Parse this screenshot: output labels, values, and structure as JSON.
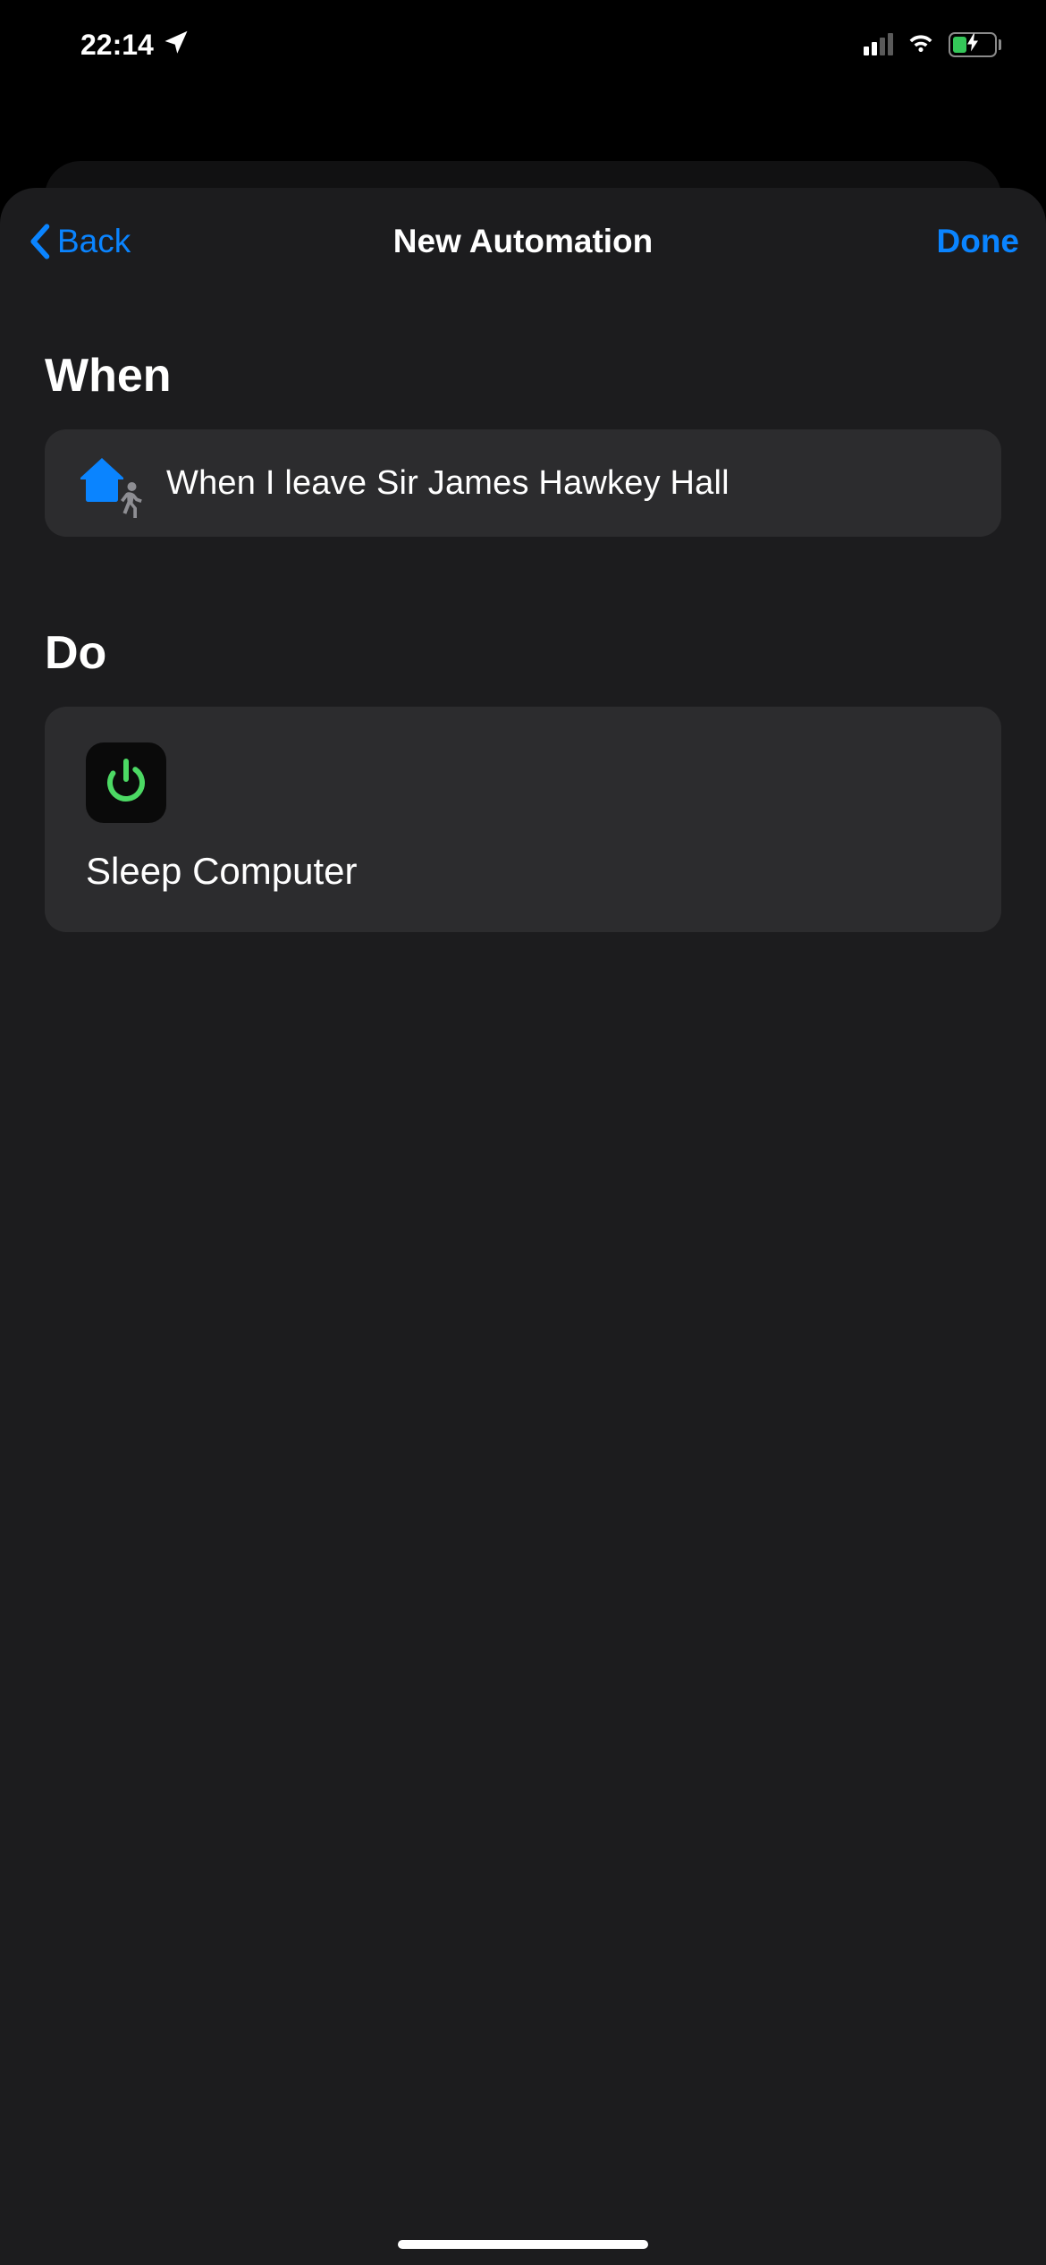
{
  "status_bar": {
    "time": "22:14"
  },
  "nav": {
    "back_label": "Back",
    "title": "New Automation",
    "done_label": "Done"
  },
  "sections": {
    "when": {
      "header": "When",
      "condition_text": "When I leave Sir James Hawkey Hall"
    },
    "do": {
      "header": "Do",
      "action_label": "Sleep Computer"
    }
  },
  "colors": {
    "accent": "#0a84ff",
    "card_bg": "#2c2c2e",
    "sheet_bg": "#1c1c1e",
    "power_green": "#4cd964"
  }
}
